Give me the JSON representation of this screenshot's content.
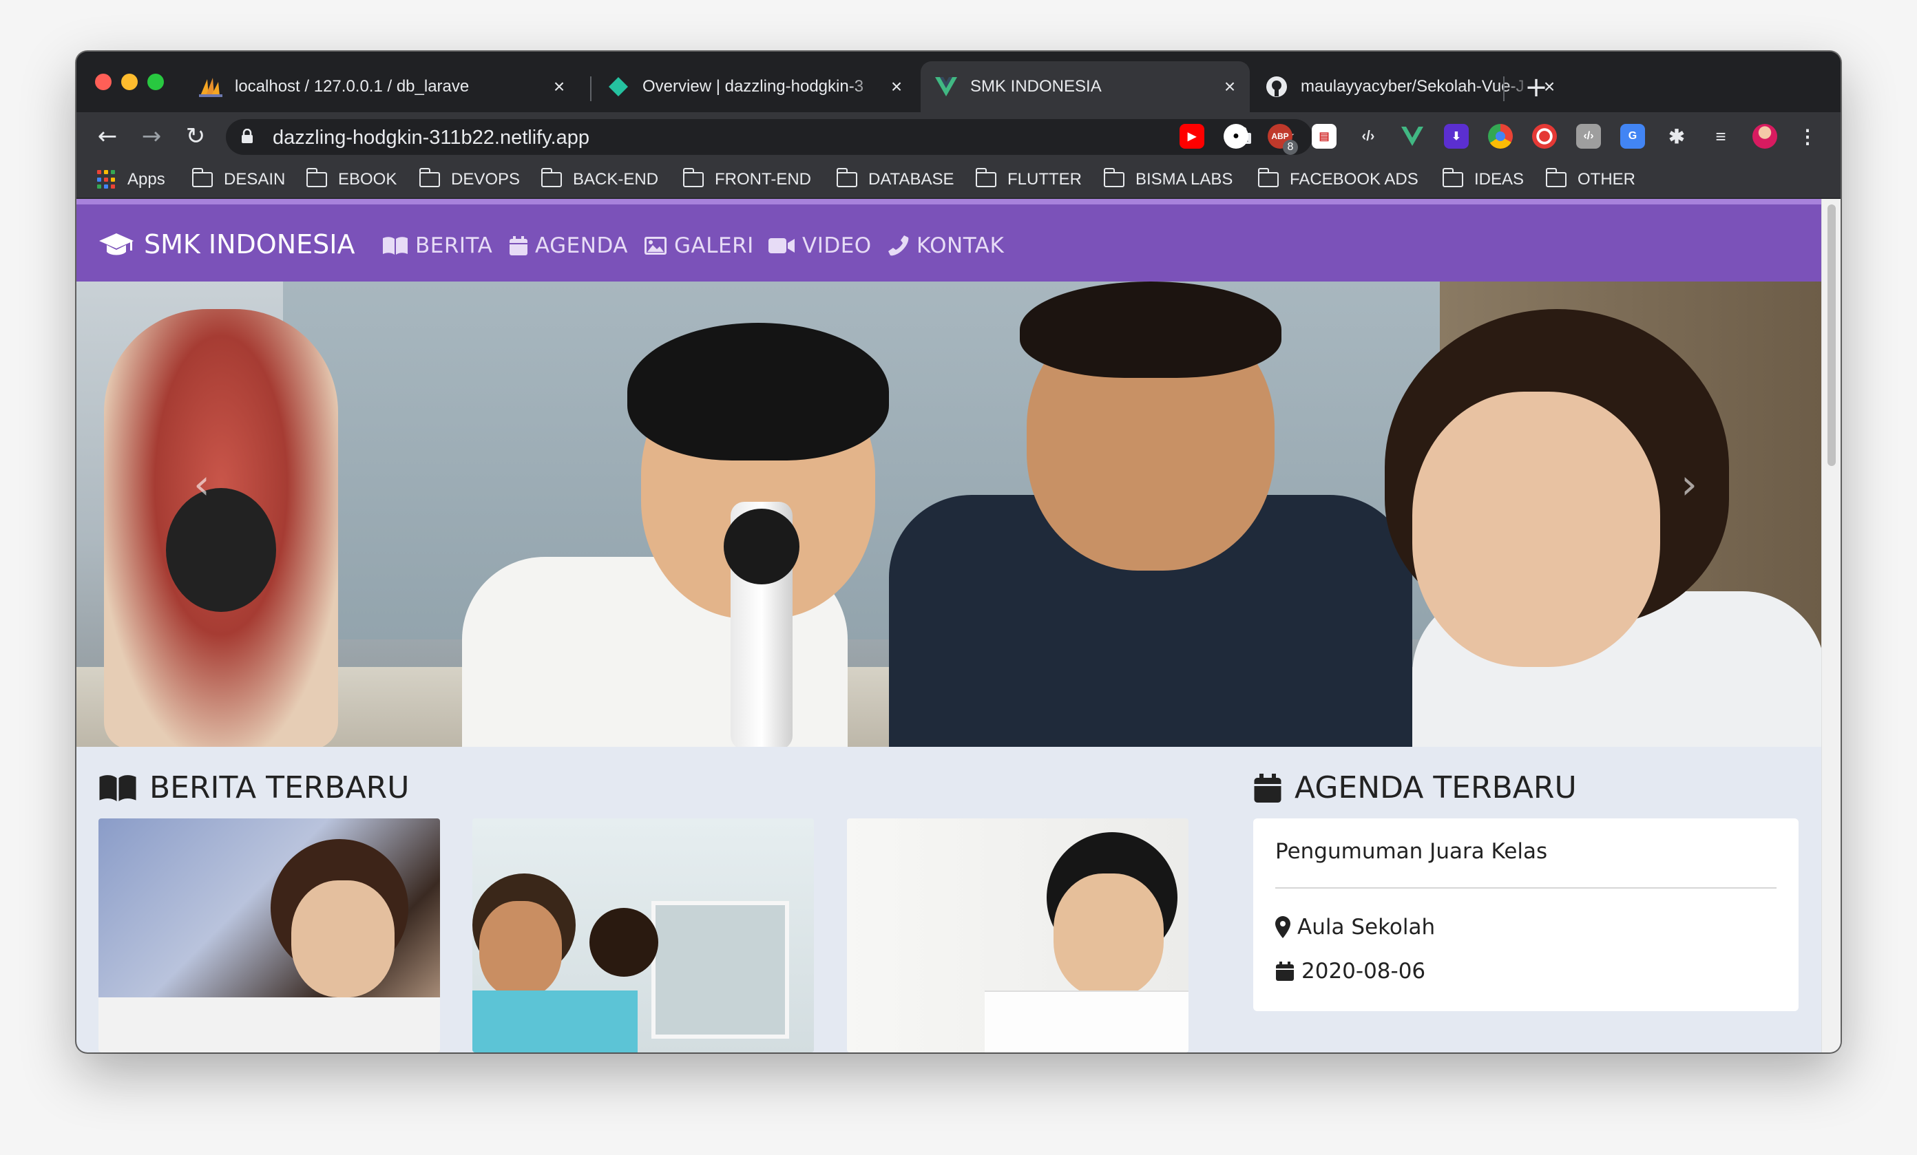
{
  "browser": {
    "tabs": [
      {
        "title": "localhost / 127.0.0.1 / db_larave",
        "icon": "phpmyadmin-icon"
      },
      {
        "title": "Overview | dazzling-hodgkin-3",
        "icon": "netlify-icon"
      },
      {
        "title": "SMK INDONESIA",
        "icon": "vue-icon",
        "active": true
      },
      {
        "title": "maulayyacyber/Sekolah-Vue-J",
        "icon": "github-icon"
      }
    ],
    "url": "dazzling-hodgkin-311b22.netlify.app",
    "extension_badge": "8",
    "extension_label": "ABP",
    "bookmarks": {
      "apps": "Apps",
      "folders": [
        "DESAIN",
        "EBOOK",
        "DEVOPS",
        "BACK-END",
        "FRONT-END",
        "DATABASE",
        "FLUTTER",
        "BISMA LABS",
        "FACEBOOK ADS",
        "IDEAS",
        "OTHER"
      ]
    }
  },
  "site": {
    "brand": "SMK INDONESIA",
    "nav": [
      "BERITA",
      "AGENDA",
      "GALERI",
      "VIDEO",
      "KONTAK"
    ],
    "accent": "#7b52b9",
    "news_heading": "BERITA TERBARU",
    "agenda_heading": "AGENDA TERBARU",
    "agenda": {
      "title": "Pengumuman Juara Kelas",
      "location": "Aula Sekolah",
      "date": "2020-08-06"
    }
  }
}
